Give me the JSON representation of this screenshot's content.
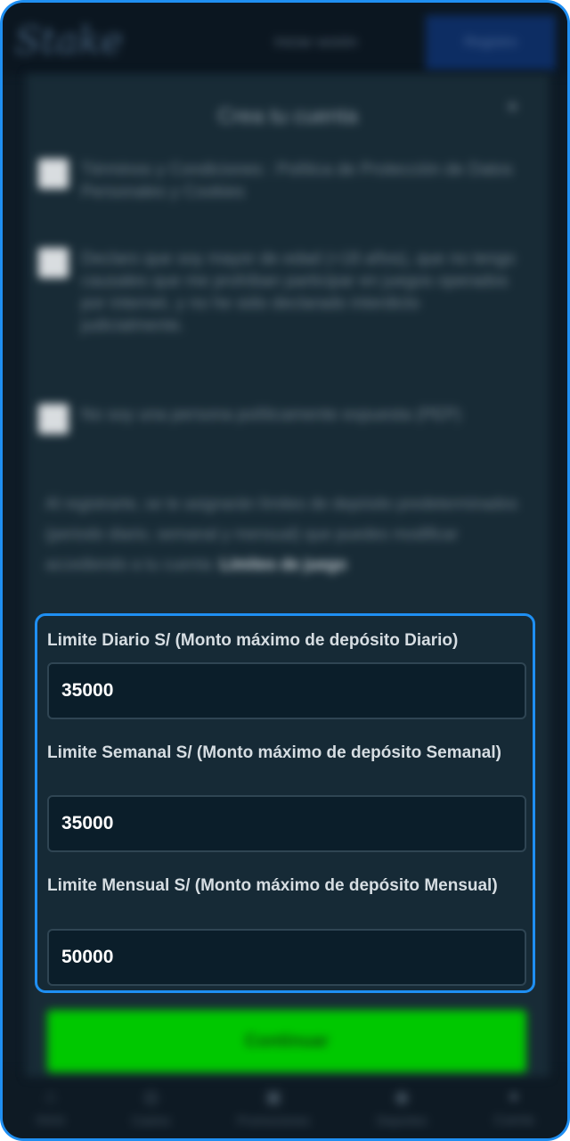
{
  "header": {
    "logo": "Stake",
    "login_label": "Iniciar sesión",
    "register_label": "Registro"
  },
  "modal": {
    "title": "Crea tu cuenta",
    "close_glyph": "×",
    "checkboxes": [
      {
        "label": "Términos y Condiciones : Política de Protección de Datos Personales y Cookies"
      },
      {
        "label": "Declaro que soy mayor de edad (+18 años), que no tengo causales que me prohíban participar en juegos operados por internet, y no he sido declarado interdicto judicialmente."
      },
      {
        "label": "No soy una persona políticamente expuesta (PEP)"
      }
    ],
    "info_text": "Al registrarte, se te asignarán límites de depósito predeterminados (periodo diario, semanal y mensual) que puedes modificar accediendo a tu cuenta:",
    "info_link": "Límites de juego",
    "limits": {
      "daily": {
        "label": "Limite Diario S/ (Monto máximo de depósito Diario)",
        "value": "35000"
      },
      "weekly": {
        "label": "Limite Semanal S/ (Monto máximo de depósito Semanal)",
        "value": "35000"
      },
      "monthly": {
        "label": "Limite Mensual S/ (Monto máximo de depósito Mensual)",
        "value": "50000"
      }
    },
    "continue_label": "Continuar"
  },
  "bottom_nav": [
    {
      "label": "Inicio",
      "icon": "home-icon",
      "glyph": "⌂"
    },
    {
      "label": "Casino",
      "icon": "casino-icon",
      "glyph": "◎"
    },
    {
      "label": "Promociones",
      "icon": "gift-icon",
      "glyph": "▣"
    },
    {
      "label": "Deportes",
      "icon": "sports-icon",
      "glyph": "◉"
    },
    {
      "label": "Cuenta",
      "icon": "account-icon",
      "glyph": "●"
    }
  ],
  "colors": {
    "accent": "#1f8ff2",
    "continue_button": "#00c800",
    "background": "#0e1b26"
  }
}
